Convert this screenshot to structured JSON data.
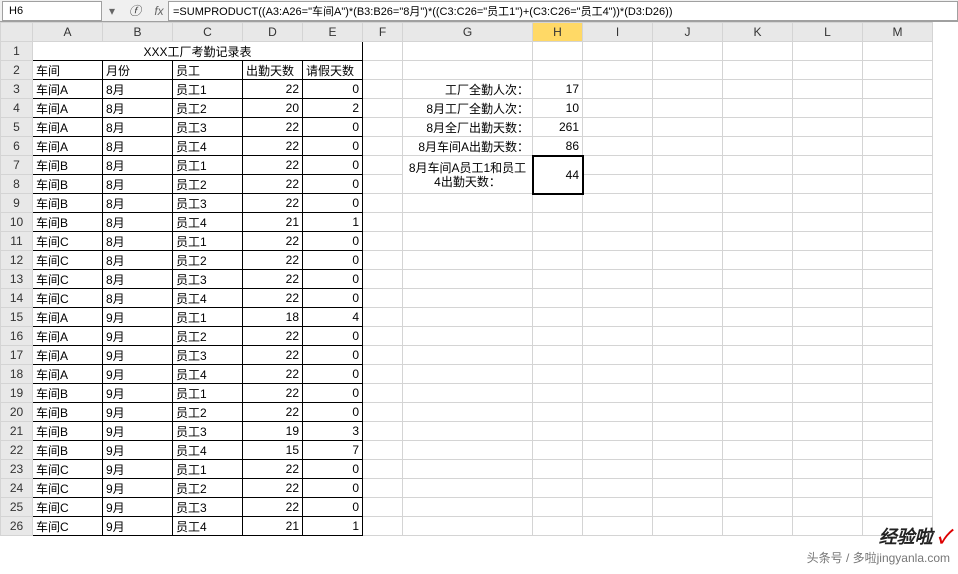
{
  "name_box": "H6",
  "formula": "=SUMPRODUCT((A3:A26=\"车间A\")*(B3:B26=\"8月\")*((C3:C26=\"员工1\")+(C3:C26=\"员工4\"))*(D3:D26))",
  "title": "XXX工厂考勤记录表",
  "headers": {
    "A": "车间",
    "B": "月份",
    "C": "员工",
    "D": "出勤天数",
    "E": "请假天数"
  },
  "col_letters": [
    "A",
    "B",
    "C",
    "D",
    "E",
    "F",
    "G",
    "H",
    "I",
    "J",
    "K",
    "L",
    "M"
  ],
  "rows": [
    {
      "a": "车间A",
      "b": "8月",
      "c": "员工1",
      "d": "22",
      "e": "0"
    },
    {
      "a": "车间A",
      "b": "8月",
      "c": "员工2",
      "d": "20",
      "e": "2"
    },
    {
      "a": "车间A",
      "b": "8月",
      "c": "员工3",
      "d": "22",
      "e": "0"
    },
    {
      "a": "车间A",
      "b": "8月",
      "c": "员工4",
      "d": "22",
      "e": "0"
    },
    {
      "a": "车间B",
      "b": "8月",
      "c": "员工1",
      "d": "22",
      "e": "0"
    },
    {
      "a": "车间B",
      "b": "8月",
      "c": "员工2",
      "d": "22",
      "e": "0"
    },
    {
      "a": "车间B",
      "b": "8月",
      "c": "员工3",
      "d": "22",
      "e": "0"
    },
    {
      "a": "车间B",
      "b": "8月",
      "c": "员工4",
      "d": "21",
      "e": "1"
    },
    {
      "a": "车间C",
      "b": "8月",
      "c": "员工1",
      "d": "22",
      "e": "0"
    },
    {
      "a": "车间C",
      "b": "8月",
      "c": "员工2",
      "d": "22",
      "e": "0"
    },
    {
      "a": "车间C",
      "b": "8月",
      "c": "员工3",
      "d": "22",
      "e": "0"
    },
    {
      "a": "车间C",
      "b": "8月",
      "c": "员工4",
      "d": "22",
      "e": "0"
    },
    {
      "a": "车间A",
      "b": "9月",
      "c": "员工1",
      "d": "18",
      "e": "4"
    },
    {
      "a": "车间A",
      "b": "9月",
      "c": "员工2",
      "d": "22",
      "e": "0"
    },
    {
      "a": "车间A",
      "b": "9月",
      "c": "员工3",
      "d": "22",
      "e": "0"
    },
    {
      "a": "车间A",
      "b": "9月",
      "c": "员工4",
      "d": "22",
      "e": "0"
    },
    {
      "a": "车间B",
      "b": "9月",
      "c": "员工1",
      "d": "22",
      "e": "0"
    },
    {
      "a": "车间B",
      "b": "9月",
      "c": "员工2",
      "d": "22",
      "e": "0"
    },
    {
      "a": "车间B",
      "b": "9月",
      "c": "员工3",
      "d": "19",
      "e": "3"
    },
    {
      "a": "车间B",
      "b": "9月",
      "c": "员工4",
      "d": "15",
      "e": "7"
    },
    {
      "a": "车间C",
      "b": "9月",
      "c": "员工1",
      "d": "22",
      "e": "0"
    },
    {
      "a": "车间C",
      "b": "9月",
      "c": "员工2",
      "d": "22",
      "e": "0"
    },
    {
      "a": "车间C",
      "b": "9月",
      "c": "员工3",
      "d": "22",
      "e": "0"
    },
    {
      "a": "车间C",
      "b": "9月",
      "c": "员工4",
      "d": "21",
      "e": "1"
    }
  ],
  "stats": [
    {
      "label": "工厂全勤人次：",
      "value": "17",
      "row": 3
    },
    {
      "label": "8月工厂全勤人次：",
      "value": "10",
      "row": 4
    },
    {
      "label": "8月全厂出勤天数：",
      "value": "261",
      "row": 5
    },
    {
      "label": "8月车间A出勤天数：",
      "value": "86",
      "row": 6
    },
    {
      "label": "8月车间A员工1和员工4出勤天数：",
      "value": "44",
      "row": 7,
      "rowspan": 2
    }
  ],
  "active_cell_value": "44",
  "watermark": {
    "line1a": "经验啦",
    "line1b": "✓",
    "line2": "头条号 / 多啦jingyanla.com"
  }
}
